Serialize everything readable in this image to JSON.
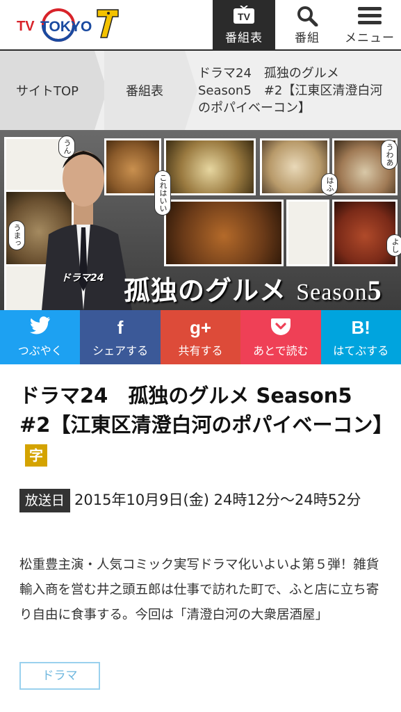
{
  "header": {
    "logo_text": "TV TOKYO",
    "nav": [
      {
        "label": "番組表",
        "icon": "tv-icon"
      },
      {
        "label": "番組",
        "icon": "search-icon"
      },
      {
        "label": "メニュー",
        "icon": "hamburger-menu-icon"
      }
    ]
  },
  "breadcrumb": {
    "items": [
      "サイトTOP",
      "番組表"
    ],
    "current": "ドラマ24　孤独のグルメ Season5　#2【江東区清澄白河のポパイベーコン】"
  },
  "hero": {
    "drama_label": "ドラマ24",
    "title": "孤独のグルメ",
    "season_word": "Season",
    "season_number": "5",
    "bubbles": [
      "うまっ",
      "これはいい",
      "はふ",
      "うわあ",
      "よし",
      "うん"
    ]
  },
  "share": [
    {
      "label": "つぶやく",
      "icon": "twitter-bird-icon",
      "glyph": "🐦",
      "color": "#1da1f2"
    },
    {
      "label": "シェアする",
      "icon": "facebook-f-icon",
      "glyph": "f",
      "color": "#3b5998"
    },
    {
      "label": "共有する",
      "icon": "google-plus-icon",
      "glyph": "g+",
      "color": "#dd4b39"
    },
    {
      "label": "あとで読む",
      "icon": "pocket-icon",
      "glyph": "❤",
      "color": "#ef4056"
    },
    {
      "label": "はてぶする",
      "icon": "hatena-bookmark-icon",
      "glyph": "B!",
      "color": "#00a4de"
    }
  ],
  "program": {
    "title": "ドラマ24　孤独のグルメ Season5　#2【江東区清澄白河のポパイベーコン】",
    "subtitle_badge": "字",
    "airing_label": "放送日",
    "airing_date": "2015年10月9日(金) 24時12分～24時52分",
    "description": "松重豊主演・人気コミック実写ドラマ化いよいよ第５弾！雑貨輸入商を営む井之頭五郎は仕事で訪れた町で、ふと店に立ち寄り自由に食事する。今回は「清澄白河の大衆居酒屋」",
    "genre_tag": "ドラマ"
  }
}
